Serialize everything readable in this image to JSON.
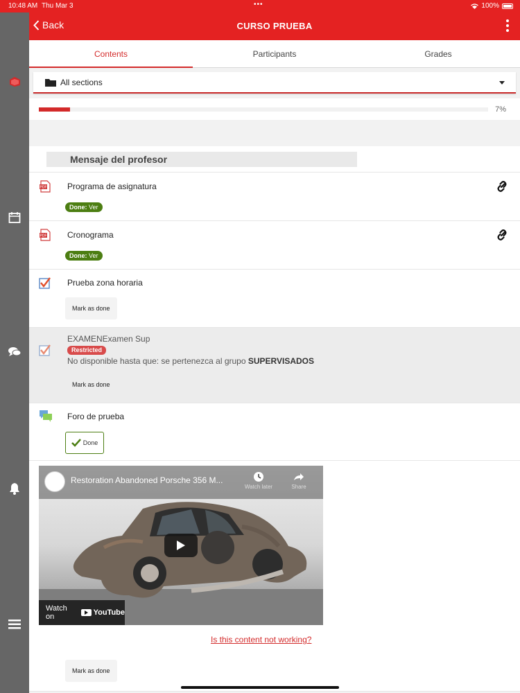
{
  "status": {
    "time": "10:48 AM",
    "date": "Thu Mar 3",
    "battery": "100%"
  },
  "header": {
    "back_label": "Back",
    "title": "CURSO PRUEBA"
  },
  "tabs": [
    {
      "label": "Contents",
      "active": true
    },
    {
      "label": "Participants"
    },
    {
      "label": "Grades"
    }
  ],
  "section_selector": {
    "value": "All sections"
  },
  "progress": {
    "percent": 7,
    "label": "7%"
  },
  "section": {
    "title": "Mensaje del profesor"
  },
  "items": [
    {
      "name": "Programa de asignatura",
      "icon": "pdf-icon",
      "completion_prefix": "Done:",
      "completion_value": "Ver"
    },
    {
      "name": "Cronograma",
      "icon": "pdf-icon",
      "completion_prefix": "Done:",
      "completion_value": "Ver"
    },
    {
      "name": "Prueba zona horaria",
      "icon": "assignment-icon",
      "button": "Mark as done"
    },
    {
      "name": "EXAMENExamen Sup",
      "icon": "assignment-icon",
      "badge": "Restricted",
      "note_prefix": "No disponible hasta que: se pertenezca al grupo",
      "note_group": "SUPERVISADOS",
      "button": "Mark as done"
    },
    {
      "name": "Foro de prueba",
      "icon": "forum-icon",
      "button": "Done"
    }
  ],
  "video": {
    "title": "Restoration Abandoned Porsche 356 M...",
    "watch_later": "Watch later",
    "share": "Share",
    "watch_on": "Watch on",
    "youtube": "YouTube",
    "not_working": "Is this content not working?",
    "button": "Mark as done"
  },
  "colors": {
    "brand": "#e42222",
    "accent": "#d32a2a",
    "done": "#4c7e12",
    "restricted": "#d84b4b",
    "rail": "#666666"
  }
}
